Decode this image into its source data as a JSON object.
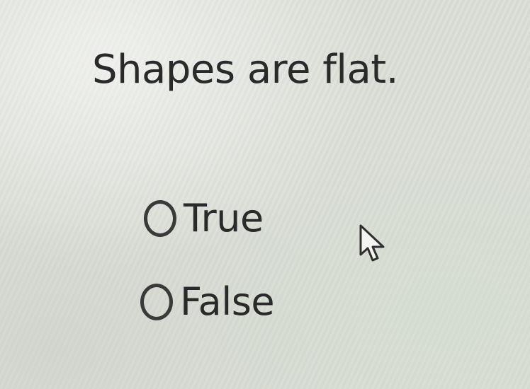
{
  "question": {
    "text": "Shapes are flat."
  },
  "options": [
    {
      "label": "True",
      "selected": false
    },
    {
      "label": "False",
      "selected": false
    }
  ],
  "cursor": {
    "icon": "arrow-cursor-icon"
  }
}
